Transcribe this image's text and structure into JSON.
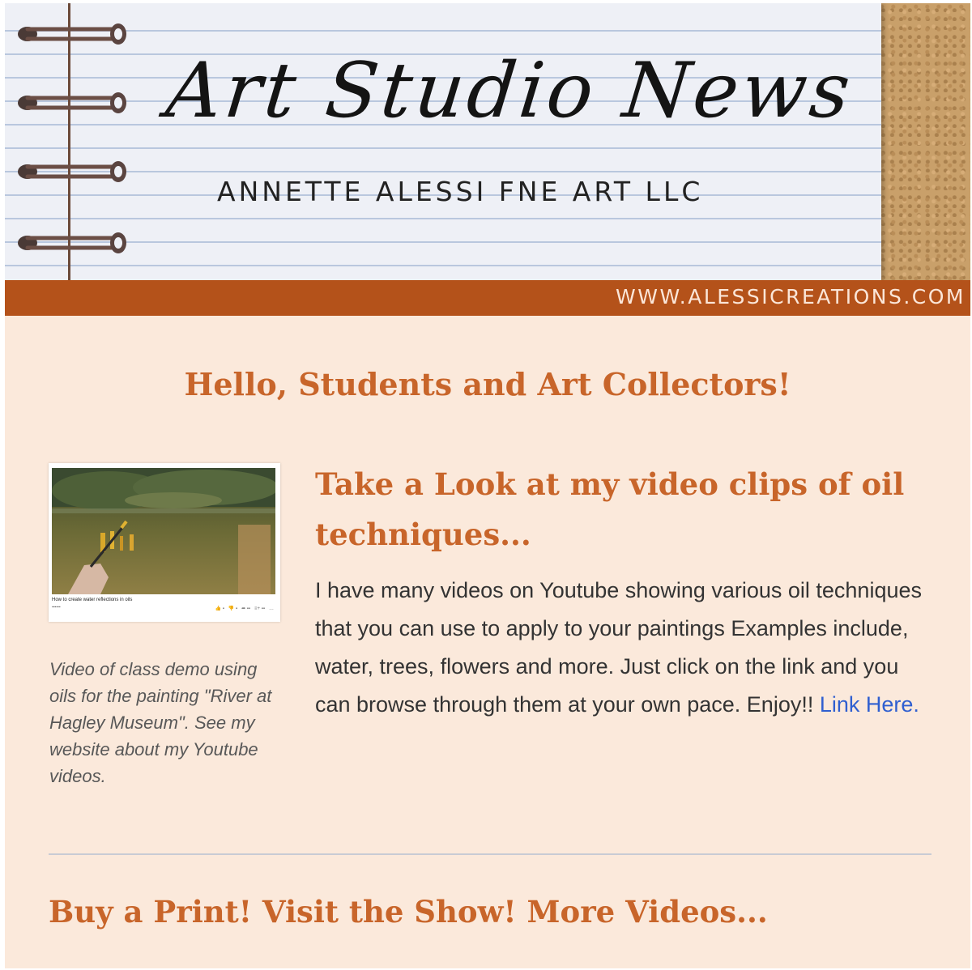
{
  "banner": {
    "title": "Art Studio News",
    "subtitle": "ANNETTE ALESSI FNE ART LLC",
    "url": "WWW.ALESSICREATIONS.COM"
  },
  "greeting": "Hello, Students and Art Collectors!",
  "video_section": {
    "thumbnail": {
      "caption": "How to create water reflections in oils"
    },
    "side_caption": "Video of class demo using oils for the painting \"River at Hagley Museum\". See my website about my Youtube videos.",
    "title": "Take a Look at my video clips of oil techniques...",
    "body": "I have many videos on Youtube showing various oil techniques that you can use to apply to your paintings Examples include, water, trees, flowers and more. Just click on the link and you can browse through them at your own pace. Enjoy!!",
    "link_label": "Link Here."
  },
  "footer_title": "Buy a Print! Visit the Show! More Videos...",
  "colors": {
    "accent": "#c8652a",
    "url_bar": "#b4521a",
    "page_background": "#fbe9db",
    "link": "#2f5fd0"
  }
}
